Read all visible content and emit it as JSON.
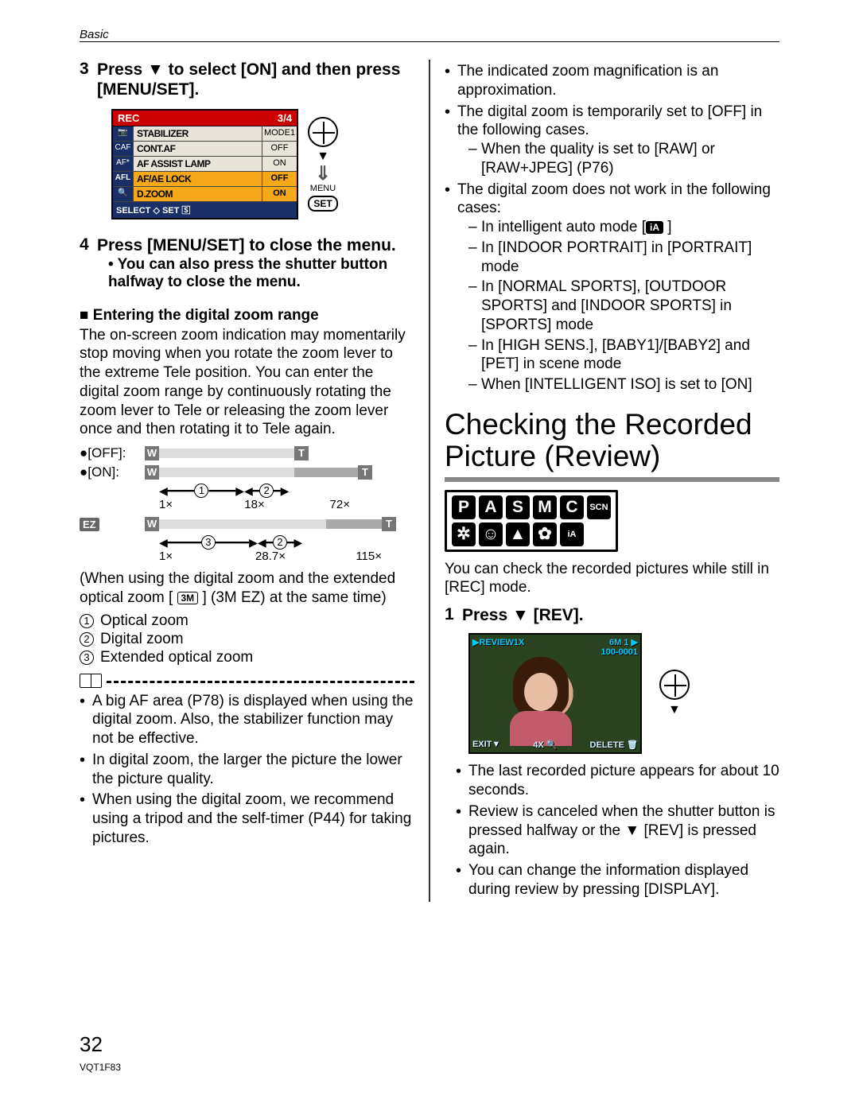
{
  "header": "Basic",
  "left": {
    "step3": {
      "num": "3",
      "title": "Press ▼ to select [ON] and then press [MENU/SET].",
      "lcd": {
        "hdr_l": "REC",
        "hdr_r": "3/4",
        "rows": [
          {
            "ic": "📷",
            "lab": "STABILIZER",
            "val": "MODE1",
            "hl": false
          },
          {
            "ic": "CAF",
            "lab": "CONT.AF",
            "val": "OFF",
            "hl": false
          },
          {
            "ic": "AF*",
            "lab": "AF ASSIST LAMP",
            "val": "ON",
            "hl": false
          },
          {
            "ic": "AFL",
            "lab": "AF/AE LOCK",
            "val": "OFF",
            "hl": true
          },
          {
            "ic": "🔍",
            "lab": "D.ZOOM",
            "val": "ON",
            "hl": true
          }
        ],
        "ftr": "SELECT ◇  SET 🅂"
      },
      "nav": {
        "menu": "MENU",
        "set": "SET"
      }
    },
    "step4": {
      "num": "4",
      "title": "Press [MENU/SET] to close the menu.",
      "sub": "You can also press the shutter button halfway to close the menu."
    },
    "sqhead": "Entering the digital zoom range",
    "sqbody": "The on-screen zoom indication may momentarily stop moving when you rotate the zoom lever to the extreme Tele position. You can enter the digital zoom range by continuously rotating the zoom lever to Tele or releasing the zoom lever once and then rotating it to Tele again.",
    "zoff": "[OFF]:",
    "zon": "[ON]:",
    "znums1": {
      "a": "1×",
      "b": "18×",
      "c": "72×"
    },
    "znums2": {
      "a": "1×",
      "b": "28.7×",
      "c": "115×"
    },
    "ez": "EZ",
    "paren": "(When using the digital zoom and the extended optical zoom [ ",
    "paren_icon": "3M",
    "paren2": " ] (3M EZ) at the same time)",
    "legend": {
      "1": "Optical zoom",
      "2": "Digital zoom",
      "3": "Extended optical zoom"
    },
    "notes": [
      "A big AF area (P78) is displayed when using the digital zoom. Also, the stabilizer function may not be effective.",
      "In digital zoom, the larger the picture the lower the picture quality.",
      "When using the digital zoom, we recommend using a tripod and the self-timer (P44) for taking pictures."
    ]
  },
  "right": {
    "top": [
      "The indicated zoom magnification is an approximation.",
      "The digital zoom is temporarily set to [OFF] in the following cases."
    ],
    "top_dash": [
      "When the quality is set to [RAW] or [RAW+JPEG] (P76)"
    ],
    "nowork": "The digital zoom does not work in the following cases:",
    "nowork_dash": [
      "In intelligent auto mode [",
      "In [INDOOR PORTRAIT] in [PORTRAIT] mode",
      "In [NORMAL SPORTS], [OUTDOOR SPORTS] and [INDOOR SPORTS] in [SPORTS] mode",
      "In [HIGH SENS.], [BABY1]/[BABY2] and [PET] in scene mode",
      "When [INTELLIGENT ISO] is set to [ON]"
    ],
    "ia_suffix": " ]",
    "title": "Checking the Recorded Picture (Review)",
    "body": "You can check the recorded pictures while still in [REC] mode.",
    "step1": {
      "num": "1",
      "title": "Press ▼ [REV]."
    },
    "review_overlay": {
      "tl": "▶REVIEW1X",
      "tr1": "6M  1 ▶",
      "tr2": "100-0001",
      "bl": "EXIT▼",
      "bm": "4X 🔍",
      "br": "DELETE 🗑"
    },
    "after": [
      "The last recorded picture appears for about 10 seconds.",
      "Review is canceled when the shutter button is pressed halfway or the ▼ [REV] is pressed again.",
      "You can change the information displayed during review by pressing [DISPLAY]."
    ]
  },
  "page_num": "32",
  "doc_code": "VQT1F83"
}
